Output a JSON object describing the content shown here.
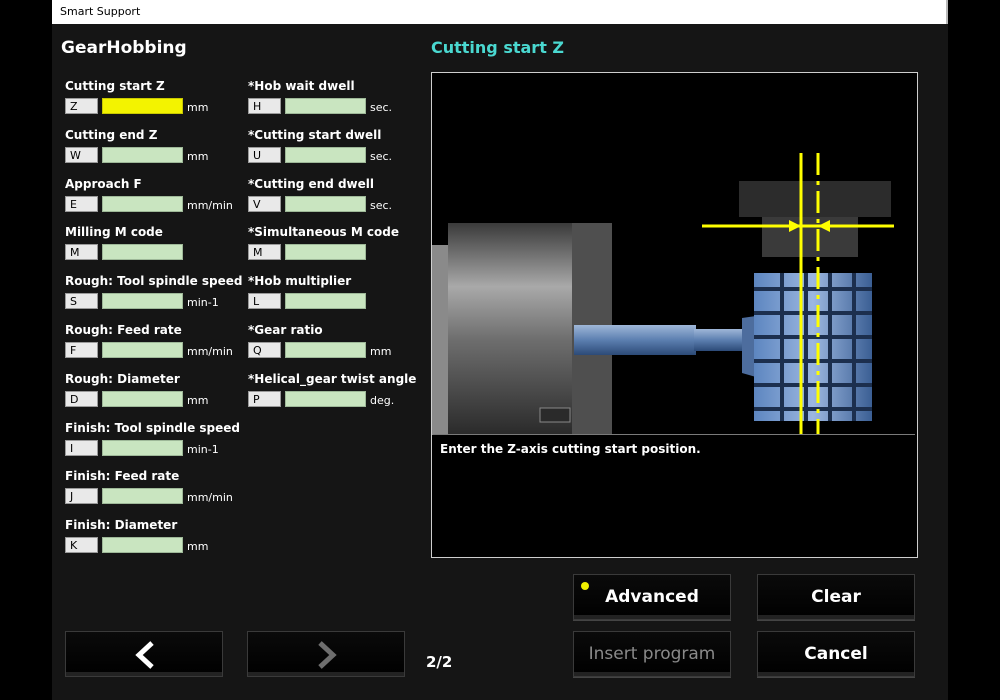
{
  "window": {
    "title": "Smart Support"
  },
  "app_name": "GearHobbing",
  "section_title": "Cutting start Z",
  "left_fields": [
    {
      "label": "Cutting start Z",
      "code": "Z",
      "value": "",
      "unit": "mm"
    },
    {
      "label": "Cutting end Z",
      "code": "W",
      "value": "",
      "unit": "mm"
    },
    {
      "label": "Approach F",
      "code": "E",
      "value": "",
      "unit": "mm/min"
    },
    {
      "label": "Milling M code",
      "code": "M",
      "value": "",
      "unit": ""
    },
    {
      "label": "Rough: Tool spindle speed",
      "code": "S",
      "value": "",
      "unit": "min-1"
    },
    {
      "label": "Rough: Feed rate",
      "code": "F",
      "value": "",
      "unit": "mm/min"
    },
    {
      "label": "Rough: Diameter",
      "code": "D",
      "value": "",
      "unit": "mm"
    },
    {
      "label": "Finish: Tool spindle speed",
      "code": "I",
      "value": "",
      "unit": "min-1"
    },
    {
      "label": "Finish: Feed rate",
      "code": "J",
      "value": "",
      "unit": "mm/min"
    },
    {
      "label": "Finish: Diameter",
      "code": "K",
      "value": "",
      "unit": "mm"
    }
  ],
  "right_fields": [
    {
      "label": "*Hob wait dwell",
      "code": "H",
      "value": "",
      "unit": "sec."
    },
    {
      "label": "*Cutting start dwell",
      "code": "U",
      "value": "",
      "unit": "sec."
    },
    {
      "label": "*Cutting end dwell",
      "code": "V",
      "value": "",
      "unit": "sec."
    },
    {
      "label": "*Simultaneous M code",
      "code": "M",
      "value": "",
      "unit": ""
    },
    {
      "label": "*Hob multiplier",
      "code": "L",
      "value": "",
      "unit": ""
    },
    {
      "label": "*Gear ratio",
      "code": "Q",
      "value": "",
      "unit": "mm"
    },
    {
      "label": "*Helical_gear twist angle",
      "code": "P",
      "value": "",
      "unit": "deg."
    }
  ],
  "description": "Enter the Z-axis cutting start position.",
  "buttons": {
    "advanced": "Advanced",
    "clear": "Clear",
    "insert_program": "Insert program",
    "cancel": "Cancel"
  },
  "page_indicator": "2/2",
  "colors": {
    "accent_title": "#4ad8d0",
    "active_field": "#f3f300",
    "field_bg": "#c9e5c0",
    "guide_lines": "#ffff00"
  },
  "icons": {
    "prev": "chevron-left-icon",
    "next": "chevron-right-icon",
    "advanced_indicator": "yellow-dot-icon"
  }
}
